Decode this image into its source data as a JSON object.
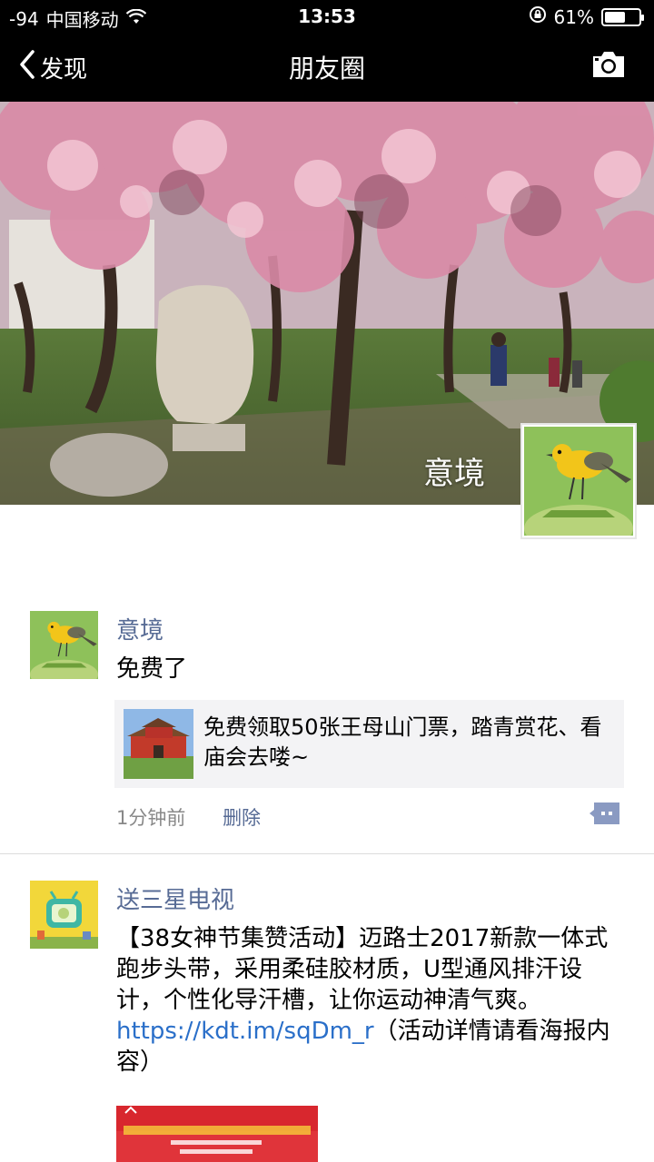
{
  "status_bar": {
    "signal": "-94",
    "carrier": "中国移动",
    "time": "13:53",
    "battery": "61%",
    "battery_level": 0.61
  },
  "nav": {
    "back_label": "发现",
    "title": "朋友圈",
    "camera_icon": "camera-icon"
  },
  "cover": {
    "user_name": "意境"
  },
  "posts": [
    {
      "name": "意境",
      "text": "免费了",
      "share": {
        "text": "免费领取50张王母山门票，踏青赏花、看庙会去喽~"
      },
      "time": "1分钟前",
      "delete_label": "删除"
    },
    {
      "name": "送三星电视",
      "text_before_link": "【38女神节集赞活动】迈路士2017新款一体式跑步头带，采用柔硅胶材质，U型通风排汗设计，个性化导汗槽，让你运动神清气爽。",
      "link": "https://kdt.im/sqDm_r",
      "text_after_link": "（活动详情请看海报内容）"
    }
  ]
}
